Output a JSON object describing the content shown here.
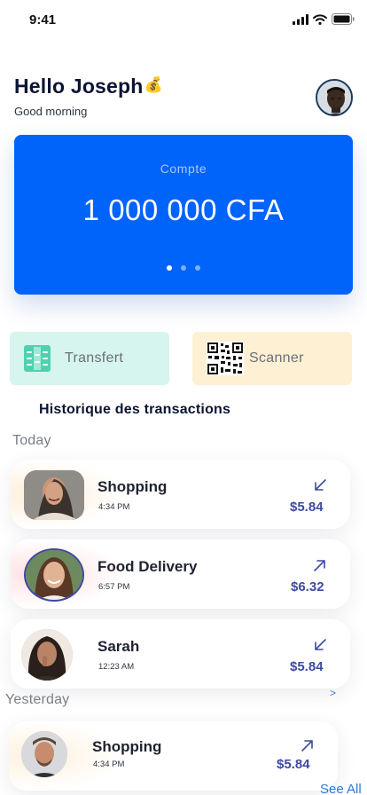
{
  "status": {
    "time": "9:41"
  },
  "header": {
    "greeting": "Hello Joseph",
    "emoji": "💰",
    "subtitle": "Good morning"
  },
  "card": {
    "label": "Compte",
    "amount": "1 000 000 CFA",
    "pages": 3,
    "active_page": 1
  },
  "actions": {
    "transfer_label": "Transfert",
    "scanner_label": "Scanner"
  },
  "history": {
    "title": "Historique des transactions",
    "today_label": "Today",
    "yesterday_label": "Yesterday",
    "see_all": "See All",
    "chevron": ">",
    "items": [
      {
        "name": "Shopping",
        "time": "4:34 PM",
        "amount": "$5.84",
        "direction": "incoming"
      },
      {
        "name": "Food Delivery",
        "time": "6:57 PM",
        "amount": "$6.32",
        "direction": "outgoing"
      },
      {
        "name": "Sarah",
        "time": "12:23 AM",
        "amount": "$5.84",
        "direction": "incoming"
      },
      {
        "name": "Shopping",
        "time": "4:34 PM",
        "amount": "$5.84",
        "direction": "outgoing"
      }
    ]
  },
  "colors": {
    "primary": "#0063fa",
    "amount": "#3d4aa0",
    "transfer_bg": "#d5f5ee",
    "scanner_bg": "#fdf0d3",
    "transfer_icon": "#4fd1b0"
  }
}
